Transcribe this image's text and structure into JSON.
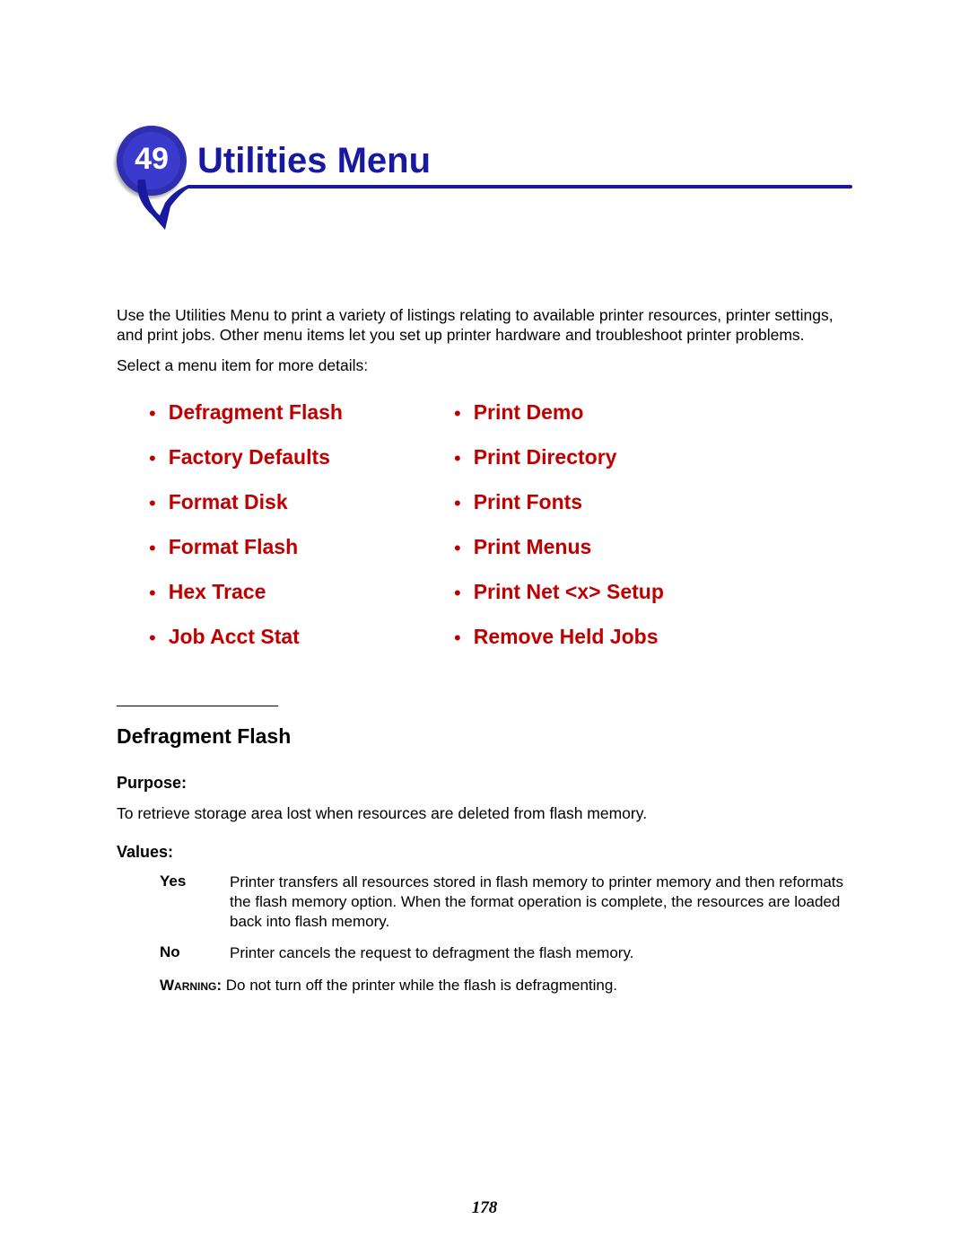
{
  "header": {
    "chapter_number": "49",
    "title": "Utilities Menu"
  },
  "intro": "Use the Utilities Menu to print a variety of listings relating to available printer resources, printer settings, and print jobs. Other menu items let you set up printer hardware and troubleshoot printer problems.",
  "select_prompt": "Select a menu item for more details:",
  "menu": {
    "left": [
      "Defragment Flash",
      "Factory Defaults",
      "Format Disk",
      "Format Flash",
      "Hex Trace",
      "Job Acct Stat"
    ],
    "right": [
      "Print Demo",
      "Print Directory",
      "Print Fonts",
      "Print Menus",
      "Print Net <x> Setup",
      "Remove Held Jobs"
    ]
  },
  "defragment": {
    "heading": "Defragment Flash",
    "purpose_label": "Purpose:",
    "purpose_text": "To retrieve storage area lost when resources are deleted from flash memory.",
    "values_label": "Values:",
    "values": [
      {
        "key": "Yes",
        "desc": "Printer transfers all resources stored in flash memory to printer memory and then reformats the flash memory option. When the format operation is complete, the resources are loaded back into flash memory."
      },
      {
        "key": "No",
        "desc": "Printer cancels the request to defragment the flash memory."
      }
    ],
    "warning_label": "Warning:",
    "warning_text": " Do not turn off the printer while the flash is defragmenting."
  },
  "page_number": "178"
}
